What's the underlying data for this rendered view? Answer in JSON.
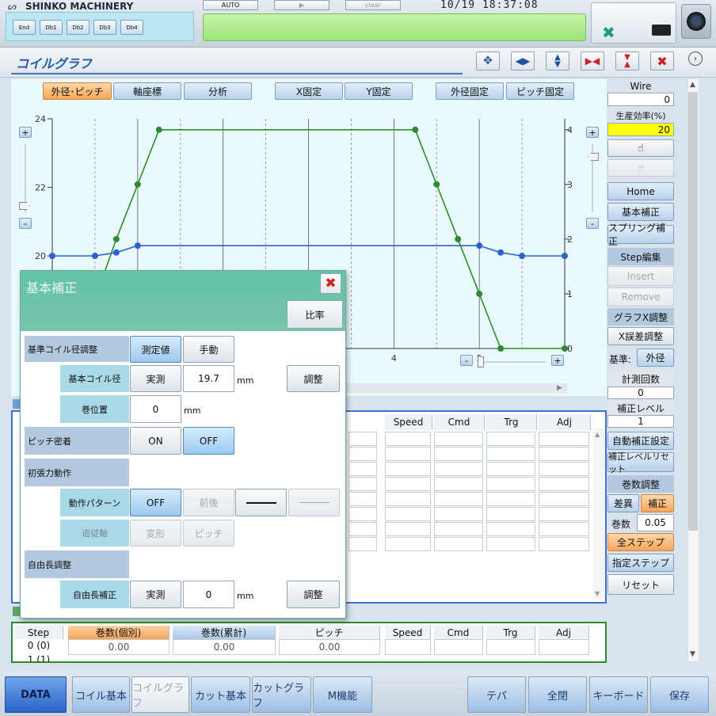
{
  "header": {
    "brand": "SHINKO MACHINERY",
    "mode": "AUTO",
    "play": "▶",
    "clear": "clear",
    "datetime": "10/19 18:37:08",
    "db_buttons": [
      "End",
      "Db1",
      "Db2",
      "Db3",
      "Db4"
    ]
  },
  "window": {
    "title": "コイルグラフ"
  },
  "graph_tabs": [
    "外径･ピッチ",
    "軸座標",
    "分析",
    "X固定",
    "Y固定",
    "外径固定",
    "ピッチ固定"
  ],
  "chart_data": {
    "type": "line",
    "x_tick_labels": [
      "4",
      "5"
    ],
    "left_axis": {
      "ticks": [
        "20",
        "22",
        "24"
      ],
      "ylim": [
        17.3,
        24
      ]
    },
    "right_axis": {
      "ticks": [
        "0",
        "1",
        "2",
        "3",
        "4"
      ],
      "ylim": [
        0,
        4.2
      ]
    },
    "series": [
      {
        "color": "#2f5fd6",
        "axis": "left",
        "x": [
          0,
          0.5,
          0.75,
          1,
          5,
          5.25,
          5.5,
          6
        ],
        "y": [
          20,
          20,
          20.1,
          20.3,
          20.3,
          20.1,
          20,
          20
        ]
      },
      {
        "color": "#2e8b2e",
        "axis": "right",
        "x": [
          0.5,
          0.75,
          1,
          1.25,
          4.25,
          4.5,
          4.75,
          5,
          5.25,
          6
        ],
        "y": [
          0.9,
          2,
          3,
          4,
          4,
          3,
          2,
          1,
          0,
          0
        ]
      }
    ]
  },
  "side": {
    "wire_label": "Wire",
    "wire_value": "0",
    "eff_label": "生産効率(%)",
    "eff_value": "20",
    "home": "Home",
    "kihon": "基本補正",
    "spring": "スプリング補正",
    "step_edit": "Step編集",
    "insert": "Insert",
    "remove": "Remove",
    "graph_x": "グラフX調整",
    "x_err": "X誤差調整",
    "kijun_label": "基準:",
    "kijun_value": "外径",
    "count_label": "計測回数",
    "count_value": "0",
    "level_label": "補正レベル",
    "level_value": "1",
    "auto_set": "自動補正設定",
    "level_reset": "補正レベルリセット",
    "turns_adj": "巻数調整",
    "diff": "差異",
    "hosei": "補正",
    "turns_label": "巻数",
    "turns_value": "0.05",
    "all_step": "全ステップ",
    "spec_step": "指定ステップ",
    "reset": "リセット"
  },
  "table1": {
    "headers": [
      "Speed",
      "Cmd",
      "Trg",
      "Adj"
    ]
  },
  "table2": {
    "headers": [
      "Step",
      "巻数(個別)",
      "巻数(累計)",
      "ピッチ",
      "Speed",
      "Cmd",
      "Trg",
      "Adj"
    ],
    "row": [
      "0 (0)",
      "0.00",
      "0.00",
      "0.00"
    ],
    "row2": "1 (1)"
  },
  "dialog": {
    "title": "基本補正",
    "ratio": "比率",
    "ref_label": "基準コイル径調整",
    "measured": "測定値",
    "manual": "手動",
    "base_label": "基本コイル径",
    "actual": "実測",
    "base_value": "19.7",
    "unit": "mm",
    "adjust": "調整",
    "pos_label": "巻位置",
    "pos_value": "0",
    "pitch_label": "ピッチ密着",
    "on": "ON",
    "off": "OFF",
    "tension_label": "初張力動作",
    "pattern_label": "動作パターン",
    "zengo": "前後",
    "follow_label": "追従軸",
    "henkei": "変形",
    "pitch": "ピッチ",
    "free_label": "自由長調整",
    "free_corr": "自由長補正",
    "free_value": "0"
  },
  "bottom_tabs": [
    "DATA",
    "コイル基本",
    "コイルグラフ",
    "カット基本",
    "カットグラフ",
    "M機能"
  ],
  "bottom_right": [
    "テパ",
    "全閉",
    "キーボード",
    "保存"
  ]
}
